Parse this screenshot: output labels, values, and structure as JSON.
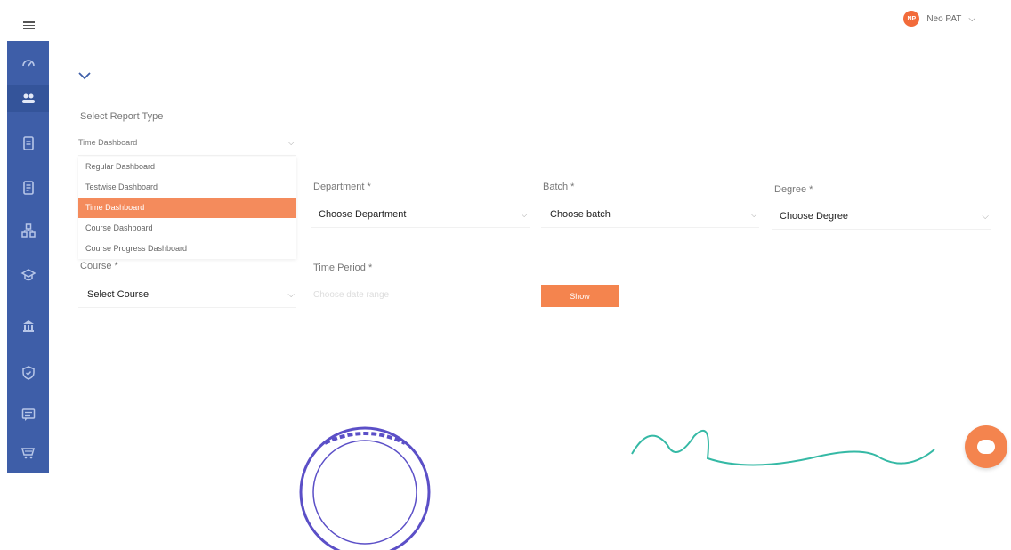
{
  "header": {
    "user_initials": "NP",
    "user_name": "Neo PAT"
  },
  "sidebar": {
    "items": [
      {
        "icon": "dashboard-icon"
      },
      {
        "icon": "users-icon",
        "active": true
      },
      {
        "icon": "document-icon"
      },
      {
        "icon": "report-icon"
      },
      {
        "icon": "network-icon"
      },
      {
        "icon": "cap-icon"
      },
      {
        "icon": "building-icon"
      },
      {
        "icon": "shield-icon"
      },
      {
        "icon": "chat-list-icon"
      },
      {
        "icon": "cart-icon"
      }
    ]
  },
  "form": {
    "report_type_label": "Select Report Type",
    "report_type_value": "Time Dashboard",
    "report_type_options": [
      "Regular Dashboard",
      "Testwise Dashboard",
      "Time Dashboard",
      "Course Dashboard",
      "Course Progress Dashboard"
    ],
    "department_label": "Department *",
    "department_value": "Choose Department",
    "batch_label": "Batch *",
    "batch_value": "Choose batch",
    "degree_label": "Degree *",
    "degree_value": "Choose Degree",
    "course_label": "Course *",
    "course_value": "Select Course",
    "time_period_label": "Time Period *",
    "time_period_placeholder": "Choose date range",
    "show_label": "Show"
  },
  "colors": {
    "sidebar": "#3e5ea8",
    "accent": "#f4844e",
    "selected_option": "#f48b5c"
  }
}
